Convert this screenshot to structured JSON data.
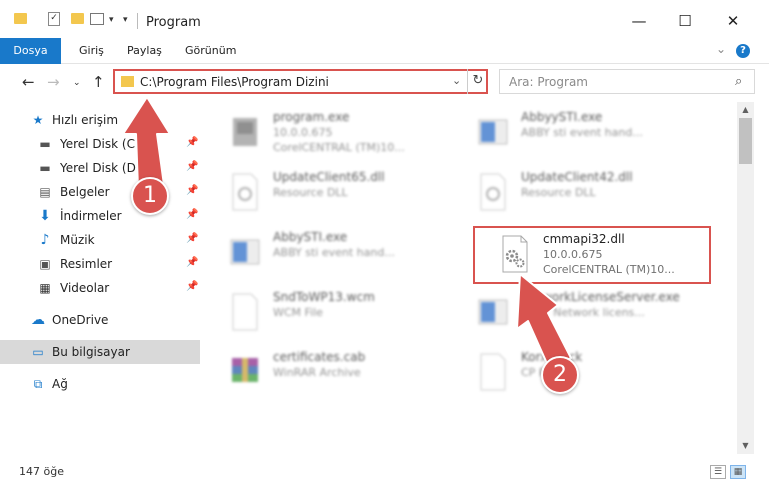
{
  "window": {
    "title": "Program"
  },
  "ribbon": {
    "tabs": [
      "Dosya",
      "Giriş",
      "Paylaş",
      "Görünüm"
    ],
    "help": "?"
  },
  "address": {
    "path": "C:\\Program Files\\Program Dizini"
  },
  "search": {
    "placeholder": "Ara: Program"
  },
  "sidebar": {
    "items": [
      {
        "label": "Hızlı erişim",
        "icon": "star-icon"
      },
      {
        "label": "Yerel Disk (C:)",
        "icon": "drive-icon"
      },
      {
        "label": "Yerel Disk (D:)",
        "icon": "drive-icon"
      },
      {
        "label": "Belgeler",
        "icon": "documents-icon"
      },
      {
        "label": "İndirmeler",
        "icon": "downloads-icon"
      },
      {
        "label": "Müzik",
        "icon": "music-icon"
      },
      {
        "label": "Resimler",
        "icon": "pictures-icon"
      },
      {
        "label": "Videolar",
        "icon": "videos-icon"
      },
      {
        "label": "OneDrive",
        "icon": "cloud-icon"
      },
      {
        "label": "Bu bilgisayar",
        "icon": "computer-icon"
      },
      {
        "label": "Ağ",
        "icon": "network-icon"
      }
    ]
  },
  "files": [
    {
      "name": "program.exe",
      "desc1": "10.0.0.675",
      "desc2": "CorelCENTRAL (TM)10...",
      "icon": "exe-icon"
    },
    {
      "name": "AbbyySTI.exe",
      "desc1": "ABBY sti event hand...",
      "desc2": "",
      "icon": "exe-icon"
    },
    {
      "name": "UpdateClient65.dll",
      "desc1": "Resource DLL",
      "desc2": "",
      "icon": "dll-icon"
    },
    {
      "name": "UpdateClient42.dll",
      "desc1": "Resource DLL",
      "desc2": "",
      "icon": "dll-icon"
    },
    {
      "name": "AbbySTI.exe",
      "desc1": "ABBY sti event hand...",
      "desc2": "",
      "icon": "exe-icon"
    },
    {
      "name": "cmmapi32.dll",
      "desc1": "10.0.0.675",
      "desc2": "CorelCENTRAL (TM)10...",
      "icon": "gear-file-icon"
    },
    {
      "name": "SndToWP13.wcm",
      "desc1": "WCM File",
      "desc2": "",
      "icon": "file-icon"
    },
    {
      "name": "NetworkLicenseServer.exe",
      "desc1": "ABBY Network licens...",
      "desc2": "",
      "icon": "exe-icon"
    },
    {
      "name": "certificates.cab",
      "desc1": "WinRAR Archive",
      "desc2": "",
      "icon": "archive-icon"
    },
    {
      "name": "Korxcheck",
      "desc1": "CP File",
      "desc2": "",
      "icon": "file-icon"
    }
  ],
  "status": {
    "count": "147 öğe"
  },
  "annotations": {
    "badge1": "1",
    "badge2": "2"
  },
  "colors": {
    "accent": "#1979ca",
    "highlight": "#d9534f"
  }
}
